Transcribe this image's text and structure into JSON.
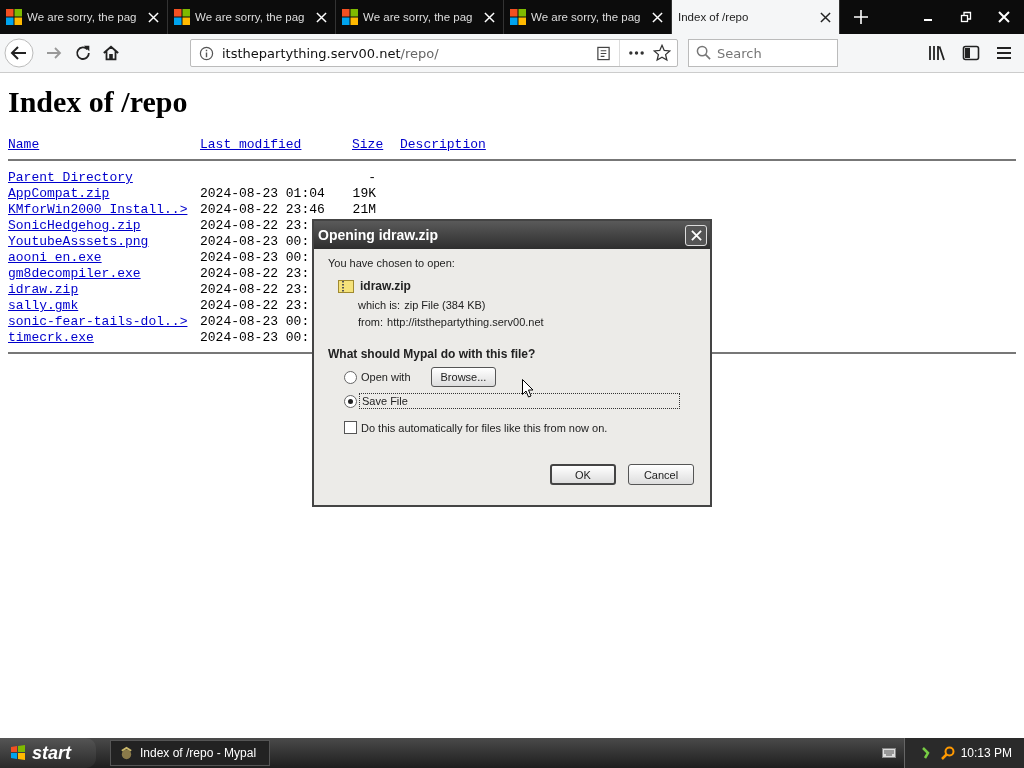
{
  "tabs": [
    {
      "title": "We are sorry, the pag",
      "selected": false
    },
    {
      "title": "We are sorry, the pag",
      "selected": false
    },
    {
      "title": "We are sorry, the pag",
      "selected": false
    },
    {
      "title": "We are sorry, the pag",
      "selected": false
    },
    {
      "title": "Index of /repo",
      "selected": true
    }
  ],
  "toolbar": {
    "url_host": "itsthepartything.serv00.net",
    "url_path": "/repo/",
    "search": {
      "placeholder": "Search"
    }
  },
  "page": {
    "heading": "Index of /repo",
    "columns": [
      "Name",
      "Last modified",
      "Size",
      "Description"
    ],
    "rows": [
      {
        "name": "Parent Directory",
        "size": "-"
      },
      {
        "name": "AppCompat.zip",
        "modified": "2024-08-23 01:04",
        "size": "19K"
      },
      {
        "name": "KMforWin2000 Install..>",
        "modified": "2024-08-22 23:46",
        "size": "21M"
      },
      {
        "name": "SonicHedgehog.zip",
        "modified": "2024-08-22 23:"
      },
      {
        "name": "YoutubeAsssets.png",
        "modified": "2024-08-23 00:"
      },
      {
        "name": "aooni en.exe",
        "modified": "2024-08-23 00:"
      },
      {
        "name": "gm8decompiler.exe",
        "modified": "2024-08-22 23:"
      },
      {
        "name": "idraw.zip",
        "modified": "2024-08-22 23:"
      },
      {
        "name": "sally.gmk",
        "modified": "2024-08-22 23:"
      },
      {
        "name": "sonic-fear-tails-dol..>",
        "modified": "2024-08-23 00:"
      },
      {
        "name": "timecrk.exe",
        "modified": "2024-08-23 00:"
      }
    ]
  },
  "dialog": {
    "title": "Opening idraw.zip",
    "intro": "You have chosen to open:",
    "file_name": "idraw.zip",
    "details": [
      {
        "label": "which is:",
        "value": "zip File (384 KB)"
      },
      {
        "label": "from:",
        "value": "http://itsthepartything.serv00.net"
      }
    ],
    "question": "What should Mypal do with this file?",
    "options": [
      {
        "label": "Open with",
        "selected": false,
        "button": "Browse..."
      },
      {
        "label": "Save File",
        "selected": true
      }
    ],
    "checkbox": {
      "label": "Do this automatically for files like this from now on.",
      "checked": false
    },
    "buttons": [
      "OK",
      "Cancel"
    ]
  },
  "taskbar": {
    "start": "start",
    "task": "Index of /repo - Mypal",
    "clock": "10:13 PM"
  }
}
